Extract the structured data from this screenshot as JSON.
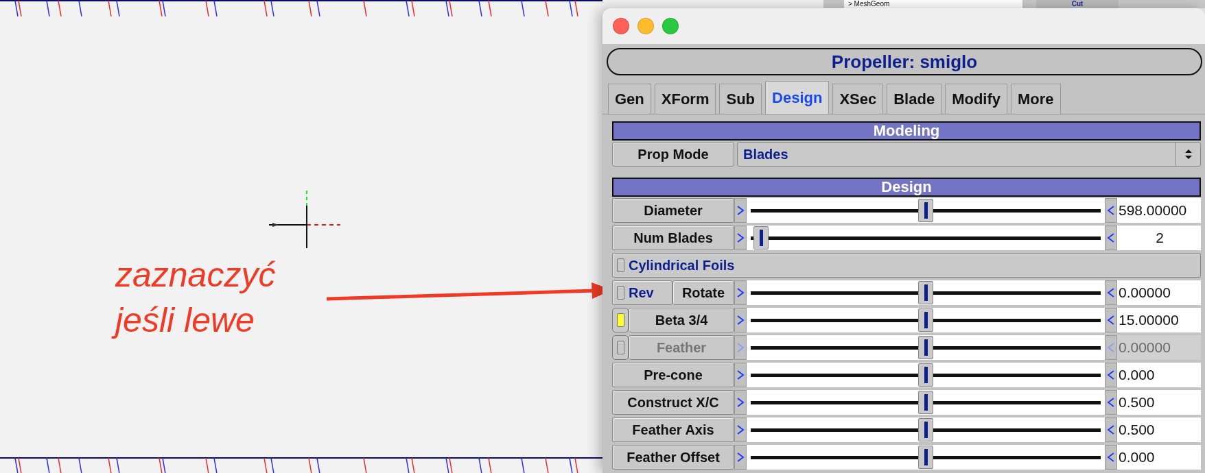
{
  "background_window": {
    "field": "> MeshGeom",
    "button": "Cut"
  },
  "annotation": {
    "lines": [
      "zaznaczyć",
      "jeśli lewe"
    ]
  },
  "dialog": {
    "title": "Propeller: smiglo",
    "tabs": [
      {
        "label": "Gen",
        "selected": false
      },
      {
        "label": "XForm",
        "selected": false
      },
      {
        "label": "Sub",
        "selected": false
      },
      {
        "label": "Design",
        "selected": true
      },
      {
        "label": "XSec",
        "selected": false
      },
      {
        "label": "Blade",
        "selected": false
      },
      {
        "label": "Modify",
        "selected": false
      },
      {
        "label": "More",
        "selected": false
      }
    ],
    "sections": [
      {
        "header": "Modeling",
        "rows": [
          {
            "kind": "choice",
            "label": "Prop Mode",
            "value": "Blades"
          }
        ]
      },
      {
        "header": "Design",
        "rows": [
          {
            "kind": "slider",
            "label": "Diameter",
            "level": 0.5,
            "value": "598.00000",
            "disabled": false
          },
          {
            "kind": "slider",
            "label": "Num Blades",
            "level": 0.03,
            "value": "2",
            "disabled": false
          },
          {
            "kind": "toggle",
            "label": "Cylindrical Foils",
            "checked": false
          },
          {
            "kind": "toggle-slider",
            "toggle": "Rev",
            "checked": false,
            "label": "Rotate",
            "level": 0.5,
            "value": "0.00000",
            "disabled": false
          },
          {
            "kind": "check-slider",
            "checked": true,
            "label": "Beta 3/4",
            "level": 0.5,
            "value": "15.00000",
            "disabled": false
          },
          {
            "kind": "check-slider",
            "checked": false,
            "label": "Feather",
            "level": 0.5,
            "value": "0.00000",
            "disabled": true
          },
          {
            "kind": "slider",
            "label": "Pre-cone",
            "level": 0.5,
            "value": "0.000",
            "disabled": false
          },
          {
            "kind": "slider",
            "label": "Construct X/C",
            "level": 0.5,
            "value": "0.500",
            "disabled": false
          },
          {
            "kind": "slider",
            "label": "Feather Axis",
            "level": 0.5,
            "value": "0.500",
            "disabled": false
          },
          {
            "kind": "slider",
            "label": "Feather Offset",
            "level": 0.5,
            "value": "0.000",
            "disabled": false
          }
        ]
      }
    ]
  }
}
